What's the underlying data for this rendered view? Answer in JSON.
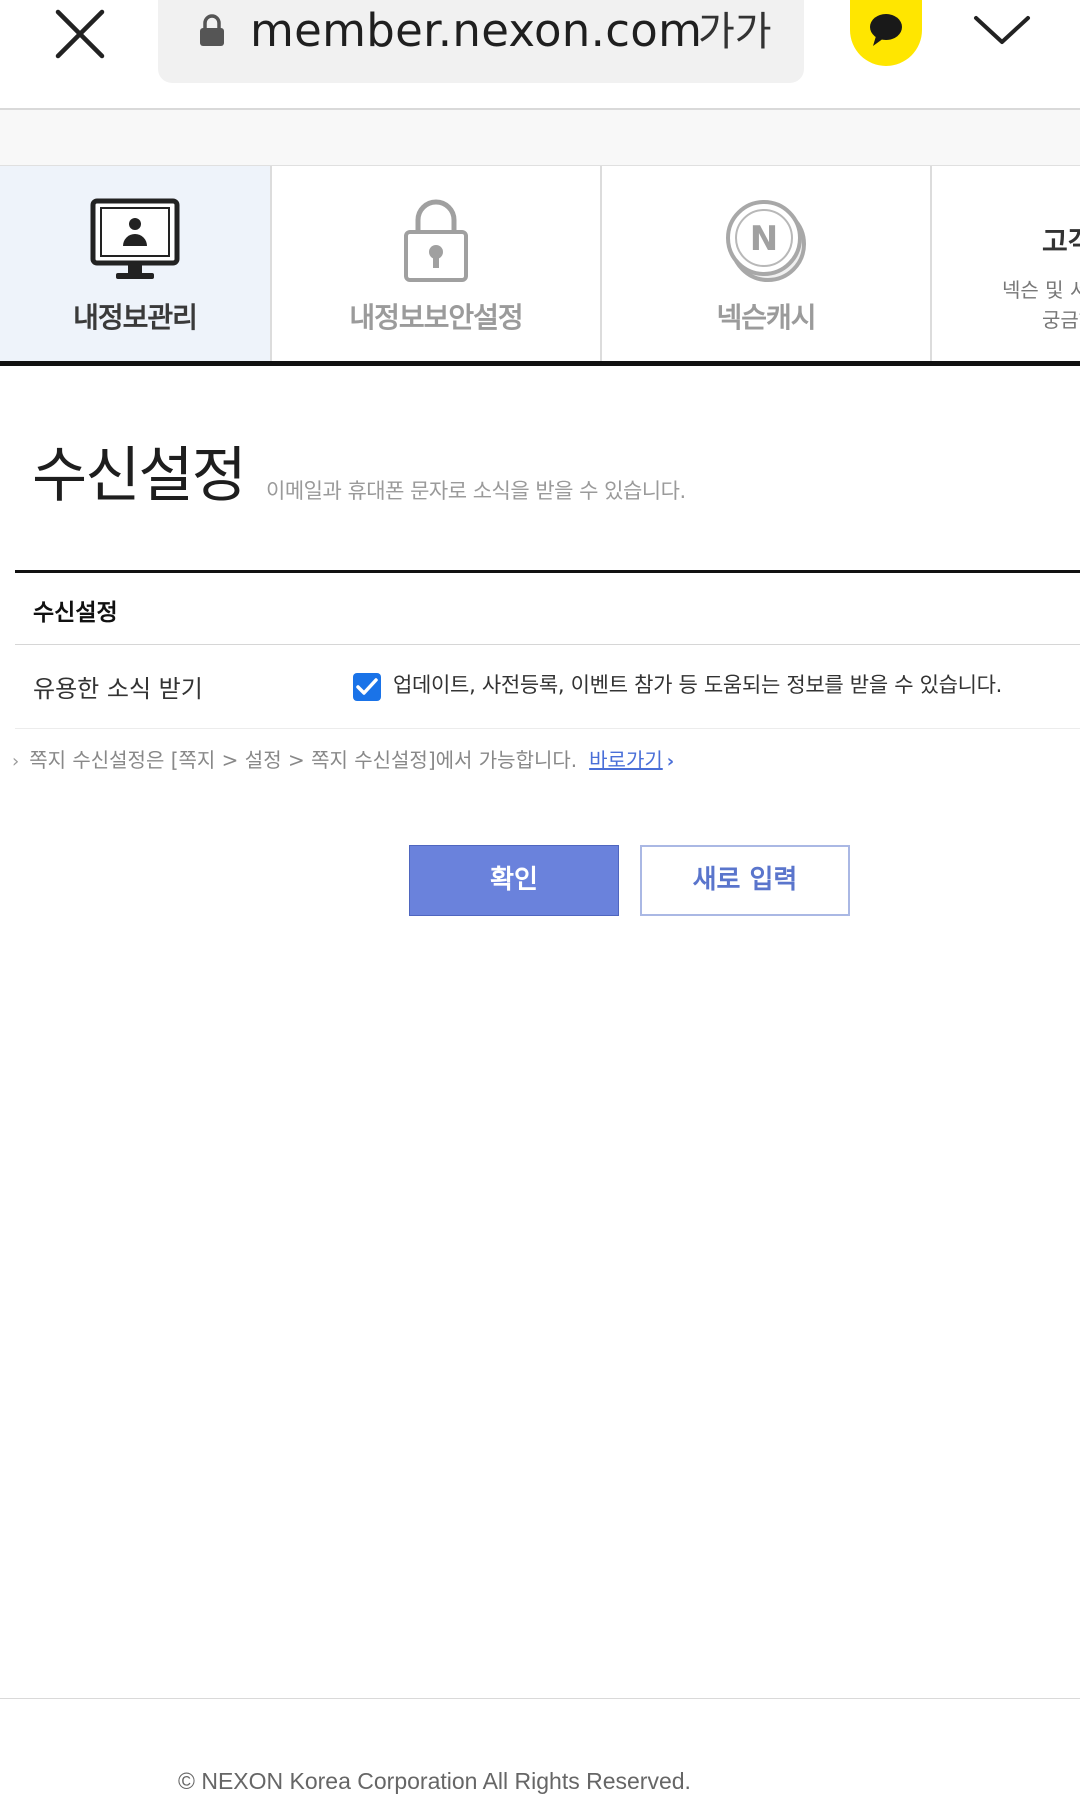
{
  "browser": {
    "url": "member.nexon.com",
    "text_size_label": "가가"
  },
  "nav": {
    "tabs": [
      {
        "label": "내정보관리",
        "icon": "monitor-user-icon",
        "active": true
      },
      {
        "label": "내정보보안설정",
        "icon": "padlock-icon",
        "active": false
      },
      {
        "label": "넥슨캐시",
        "icon": "nexon-cash-coin-icon",
        "active": false
      }
    ],
    "partial_tab": {
      "title": "고객",
      "desc_line1": "넥슨 및 서",
      "desc_line2": "궁금하"
    }
  },
  "page": {
    "title": "수신설정",
    "description": "이메일과 휴대폰 문자로 소식을 받을 수 있습니다."
  },
  "section": {
    "header": "수신설정",
    "row": {
      "label": "유용한 소식 받기",
      "checked": true,
      "text": "업데이트, 사전등록, 이벤트 참가 등 도움되는 정보를 받을 수 있습니다."
    },
    "note": {
      "arrow": "›",
      "text": "쪽지 수신설정은 [쪽지 > 설정 > 쪽지 수신설정]에서 가능합니다.",
      "link": "바로가기",
      "link_arrow": "›"
    }
  },
  "buttons": {
    "confirm": "확인",
    "reset": "새로 입력"
  },
  "footer": {
    "copyright": "© NEXON Korea Corporation All Rights Reserved."
  },
  "colors": {
    "primary_button": "#6a82dc",
    "link": "#4a6fd8",
    "checkbox": "#1a73e8",
    "kakao_yellow": "#ffe600"
  }
}
